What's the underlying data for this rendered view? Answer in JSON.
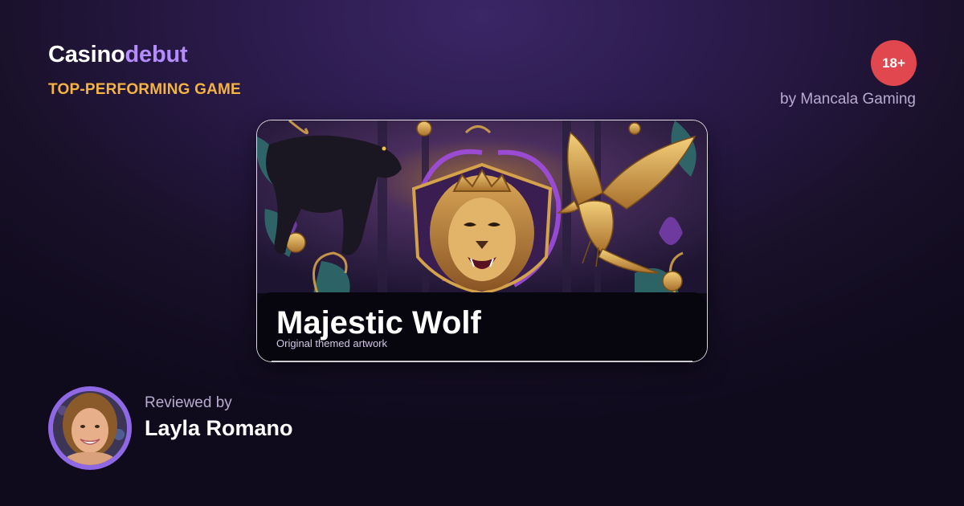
{
  "brand": {
    "part1": "Casino",
    "part2": "debut"
  },
  "tagline": "TOP-PERFORMING GAME",
  "age_badge": "18+",
  "provider": "by Mancala Gaming",
  "game": {
    "title": "Majestic Wolf",
    "subtitle": "Original themed artwork"
  },
  "reviewer": {
    "label": "Reviewed by",
    "name": "Layla Romano"
  },
  "colors": {
    "brand_accent": "#b48cff",
    "tagline": "#f5b342",
    "age_badge": "#e0474e",
    "avatar_ring": "#8f68e6"
  }
}
